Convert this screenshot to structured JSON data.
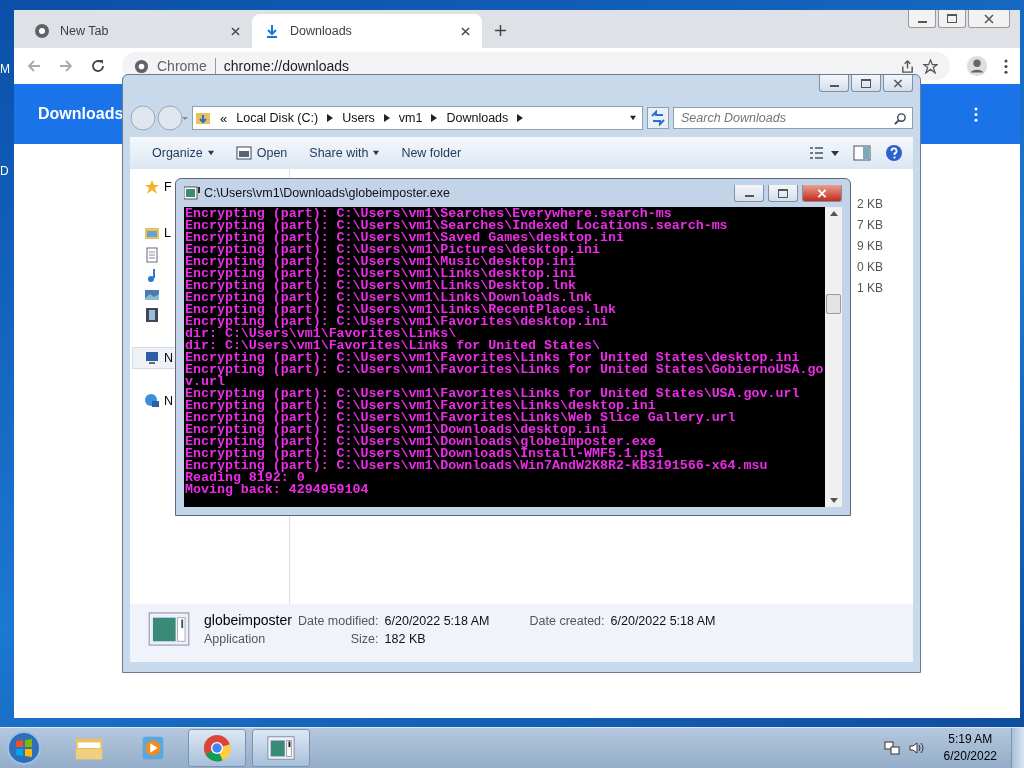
{
  "desktop": {
    "edge_labels": [
      "M",
      "D"
    ]
  },
  "chrome": {
    "tabs": [
      {
        "label": "New Tab",
        "selected": false
      },
      {
        "label": "Downloads",
        "selected": true
      }
    ],
    "address": {
      "site": "Chrome",
      "url": "chrome://downloads"
    },
    "page_title": "Downloads"
  },
  "explorer": {
    "crumb_prefix": "«",
    "breadcrumb": [
      "Local Disk (C:)",
      "Users",
      "vm1",
      "Downloads"
    ],
    "search": {
      "placeholder": "Search Downloads"
    },
    "toolbar": [
      "Organize",
      "Open",
      "Share with",
      "New folder"
    ],
    "nav_items": [
      {
        "kind": "favorites",
        "label": "F",
        "selected": false
      },
      {
        "kind": "libraries",
        "label": "L",
        "selected": false
      },
      {
        "kind": "documents",
        "selected": false
      },
      {
        "kind": "music",
        "selected": false
      },
      {
        "kind": "pictures",
        "selected": false
      },
      {
        "kind": "videos",
        "selected": false
      },
      {
        "kind": "computer",
        "label": "N",
        "selected": true
      },
      {
        "kind": "network",
        "label": "N",
        "selected": false
      }
    ],
    "sizes": [
      "2 KB",
      "7 KB",
      "9 KB",
      "0 KB",
      "1 KB"
    ],
    "details": {
      "name": "globeimposter",
      "type": "Application",
      "fields": [
        {
          "label": "Date modified:",
          "value": "6/20/2022 5:18 AM"
        },
        {
          "label": "Date created:",
          "value": "6/20/2022 5:18 AM"
        },
        {
          "label": "Size:",
          "value": "182 KB"
        }
      ]
    }
  },
  "console": {
    "title": "C:\\Users\\vm1\\Downloads\\globeimposter.exe",
    "lines": [
      "Encrypting (part): C:\\Users\\vm1\\Searches\\Everywhere.search-ms",
      "Encrypting (part): C:\\Users\\vm1\\Searches\\Indexed Locations.search-ms",
      "Encrypting (part): C:\\Users\\vm1\\Saved Games\\desktop.ini",
      "Encrypting (part): C:\\Users\\vm1\\Pictures\\desktop.ini",
      "Encrypting (part): C:\\Users\\vm1\\Music\\desktop.ini",
      "Encrypting (part): C:\\Users\\vm1\\Links\\desktop.ini",
      "Encrypting (part): C:\\Users\\vm1\\Links\\Desktop.lnk",
      "Encrypting (part): C:\\Users\\vm1\\Links\\Downloads.lnk",
      "Encrypting (part): C:\\Users\\vm1\\Links\\RecentPlaces.lnk",
      "Encrypting (part): C:\\Users\\vm1\\Favorites\\desktop.ini",
      "dir: C:\\Users\\vm1\\Favorites\\Links\\",
      "dir: C:\\Users\\vm1\\Favorites\\Links for United States\\",
      "Encrypting (part): C:\\Users\\vm1\\Favorites\\Links for United States\\desktop.ini",
      "Encrypting (part): C:\\Users\\vm1\\Favorites\\Links for United States\\GobiernoUSA.go",
      "v.url",
      "Encrypting (part): C:\\Users\\vm1\\Favorites\\Links for United States\\USA.gov.url",
      "Encrypting (part): C:\\Users\\vm1\\Favorites\\Links\\desktop.ini",
      "Encrypting (part): C:\\Users\\vm1\\Favorites\\Links\\Web Slice Gallery.url",
      "Encrypting (part): C:\\Users\\vm1\\Downloads\\desktop.ini",
      "Encrypting (part): C:\\Users\\vm1\\Downloads\\globeimposter.exe",
      "Encrypting (part): C:\\Users\\vm1\\Downloads\\Install-WMF5.1.ps1",
      "Encrypting (part): C:\\Users\\vm1\\Downloads\\Win7AndW2K8R2-KB3191566-x64.msu",
      "Reading 8192: 0",
      "Moving back: 4294959104"
    ]
  },
  "taskbar": {
    "items": [
      {
        "kind": "explorer",
        "active": false
      },
      {
        "kind": "media",
        "active": false
      },
      {
        "kind": "chrome",
        "active": true
      },
      {
        "kind": "app",
        "active": true
      }
    ],
    "time": "5:19 AM",
    "date": "6/20/2022"
  }
}
